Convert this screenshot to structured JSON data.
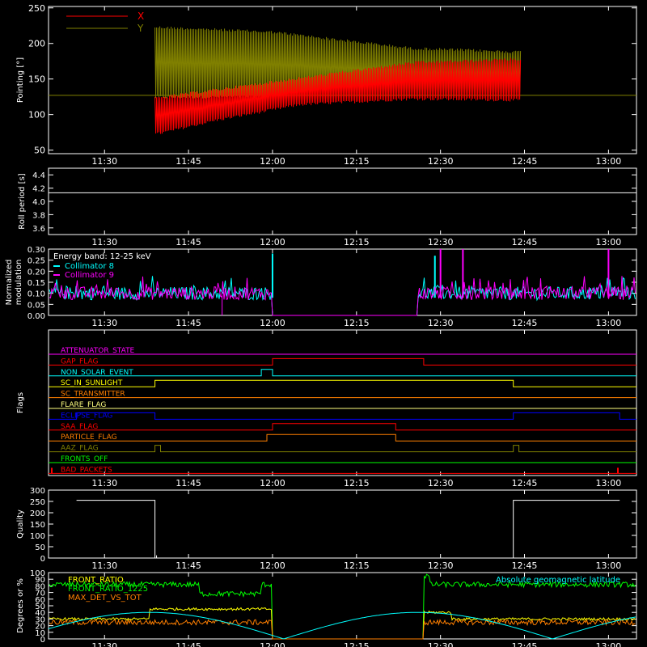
{
  "chart_data": [
    {
      "type": "line",
      "ylabel": "Pointing [°]",
      "yticks": [
        "50",
        "100",
        "150",
        "200",
        "250"
      ],
      "ylim": [
        45,
        252
      ],
      "xticks": [
        "11:30",
        "11:45",
        "12:00",
        "12:15",
        "12:30",
        "12:45",
        "13:00"
      ],
      "xlim_minutes": [
        680,
        785
      ],
      "legend": "top-left",
      "series": [
        {
          "name": "X",
          "color": "#ff0000",
          "start": "11:39",
          "end": "12:44",
          "envelope_low": [
            [
              699,
              70
            ],
            [
              710,
              90
            ],
            [
              725,
              112
            ],
            [
              745,
              120
            ],
            [
              765,
              118
            ],
            [
              784,
              120
            ]
          ],
          "envelope_high": [
            [
              699,
              125
            ],
            [
              745,
              175
            ],
            [
              784,
              185
            ]
          ]
        },
        {
          "name": "Y",
          "color": "#808000",
          "start": "11:39",
          "end": "12:44",
          "envelope_low": [
            [
              699,
              122
            ],
            [
              740,
              125
            ],
            [
              784,
              130
            ]
          ],
          "envelope_high": [
            [
              699,
              225
            ],
            [
              720,
              218
            ],
            [
              745,
              195
            ],
            [
              784,
              185
            ]
          ]
        }
      ],
      "reference_line": {
        "value": 127,
        "color": "#808000"
      }
    },
    {
      "type": "line",
      "ylabel": "Roll period [s]",
      "yticks": [
        "3.6",
        "3.8",
        "4.0",
        "4.2",
        "4.4"
      ],
      "ylim": [
        3.5,
        4.5
      ],
      "xticks": [
        "11:30",
        "11:45",
        "12:00",
        "12:15",
        "12:30",
        "12:45",
        "13:00"
      ],
      "series": [
        {
          "color": "#ffffff",
          "value": 4.13
        }
      ]
    },
    {
      "type": "line",
      "ylabel": "Normalized modulation",
      "yticks": [
        "0.00",
        "0.05",
        "0.10",
        "0.15",
        "0.20",
        "0.25",
        "0.30"
      ],
      "ylim": [
        0,
        0.3
      ],
      "xticks": [
        "11:30",
        "11:45",
        "12:00",
        "12:15",
        "12:30",
        "12:45",
        "13:00"
      ],
      "annotation": "Energy band: 12-25 keV",
      "legend": "top-left",
      "series": [
        {
          "name": "Collimator 8",
          "color": "#00ffff",
          "baseline": 0.1,
          "gap": [
            "12:00",
            "12:26"
          ],
          "spikes": [
            [
              "12:00",
              0.28
            ],
            [
              "12:29",
              0.27
            ]
          ]
        },
        {
          "name": "Collimator 9",
          "color": "#ff00ff",
          "baseline": 0.1,
          "gap": [
            "12:00",
            "12:26"
          ],
          "spikes": [
            [
              "12:30",
              0.3
            ],
            [
              "12:34",
              0.3
            ],
            [
              "13:00",
              0.3
            ]
          ]
        }
      ]
    },
    {
      "type": "line",
      "ylabel": "Flags",
      "xticks": [
        "11:30",
        "11:45",
        "12:00",
        "12:15",
        "12:30",
        "12:45",
        "13:00"
      ],
      "flags": [
        {
          "name": "ATTENUATOR_STATE",
          "color": "#ff00ff",
          "on": []
        },
        {
          "name": "SAA_FLAG_GAP_FLAG",
          "label": "GAP_FLAG",
          "color": "#ff0000",
          "on": [
            [
              "12:00",
              "12:27"
            ]
          ]
        },
        {
          "name": "NON_SOLAR_EVENT",
          "color": "#00ffff",
          "on": [
            [
              "11:58",
              "12:00"
            ]
          ]
        },
        {
          "name": "SC_IN_SUNLIGHT",
          "color": "#ffff00",
          "on": [
            [
              "11:39",
              "12:43"
            ]
          ]
        },
        {
          "name": "SC_TRANSMITTER",
          "color": "#ff7f00",
          "on": []
        },
        {
          "name": "FLARE_FLAG",
          "color": "#ffff80",
          "on": []
        },
        {
          "name": "ECLIPSE_FLAG",
          "color": "#0000ff",
          "on": [
            [
              "11:25",
              "11:39"
            ],
            [
              "12:43",
              "13:02"
            ]
          ]
        },
        {
          "name": "SAA_FLAG",
          "color": "#ff0000",
          "on": [
            [
              "12:00",
              "12:22"
            ]
          ]
        },
        {
          "name": "PARTICLE_FLAG",
          "color": "#ff7f00",
          "on": [
            [
              "11:59",
              "12:22"
            ]
          ]
        },
        {
          "name": "AAZ_FLAG",
          "color": "#808000",
          "on": [
            [
              "11:39",
              "11:40"
            ],
            [
              "12:43",
              "12:44"
            ]
          ]
        },
        {
          "name": "FRONTS_OFF",
          "color": "#00ff00",
          "on": []
        },
        {
          "name": "BAD_PACKETS",
          "color": "#ff0000",
          "on": []
        }
      ]
    },
    {
      "type": "line",
      "ylabel": "Quality",
      "yticks": [
        "0",
        "50",
        "100",
        "150",
        "200",
        "250",
        "300"
      ],
      "ylim": [
        0,
        300
      ],
      "xticks": [
        "11:30",
        "11:45",
        "12:00",
        "12:15",
        "12:30",
        "12:45",
        "13:00"
      ],
      "series": [
        {
          "color": "#ffffff",
          "points": [
            [
              "11:25",
              255
            ],
            [
              "11:39",
              255
            ],
            [
              "11:39",
              0
            ],
            [
              "12:43",
              0
            ],
            [
              "12:43",
              255
            ],
            [
              "13:02",
              255
            ]
          ]
        }
      ]
    },
    {
      "type": "line",
      "ylabel": "Degrees or %",
      "yticks": [
        "0",
        "10",
        "20",
        "30",
        "40",
        "50",
        "60",
        "70",
        "80",
        "90",
        "100"
      ],
      "ylim": [
        0,
        100
      ],
      "xticks": [
        "11:30",
        "11:45",
        "12:00",
        "12:15",
        "12:30",
        "12:45",
        "13:00"
      ],
      "legend": "top-left",
      "series": [
        {
          "name": "FRONT_RATIO",
          "color": "#ffff00"
        },
        {
          "name": "FRONT_RATIO_1225",
          "color": "#00ff00"
        },
        {
          "name": "MAX_DET_VS_TOT",
          "color": "#ff7f00"
        },
        {
          "name": "Absolute geomagnetic latitude",
          "color": "#00ffff"
        }
      ]
    }
  ]
}
